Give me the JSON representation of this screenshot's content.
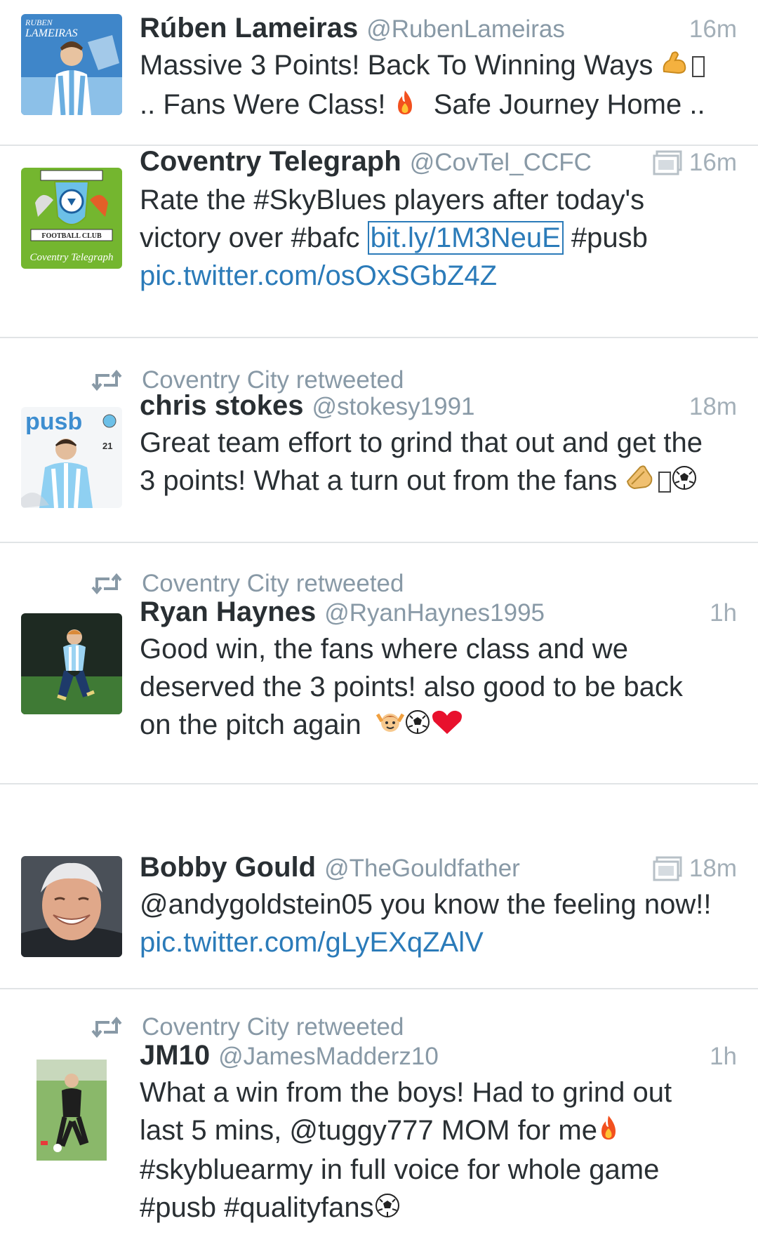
{
  "retweet_label": "Coventry City retweeted",
  "tweets": [
    {
      "name": "Rúben Lameiras",
      "handle": "@RubenLameiras",
      "time": "16m",
      "avatar_text": [
        "RUBEN",
        "LAMEIRAS"
      ],
      "lines": [
        "Massive 3 Points! Back To Winning Ways",
        ".. Fans Were Class!",
        "Safe Journey Home .."
      ]
    },
    {
      "name": "Coventry Telegraph",
      "handle": "@CovTel_CCFC",
      "time": "16m",
      "avatar_text": [
        "FOOTBALL CLUB",
        "Coventry Telegraph"
      ],
      "line1": "Rate the #SkyBlues players after today's",
      "line2_pre": "victory over #bafc ",
      "line2_link": "bit.ly/1M3NeuE",
      "line2_post": " #pusb",
      "line3_link": "pic.twitter.com/osOxSGbZ4Z"
    },
    {
      "name": "chris stokes",
      "handle": "@stokesy1991",
      "time": "18m",
      "avatar_text": [
        "pusb",
        "21"
      ],
      "lines": [
        "Great team effort to grind that out and get the",
        "3 points! What a turn out from the fans"
      ]
    },
    {
      "name": "Ryan Haynes",
      "handle": "@RyanHaynes1995",
      "time": "1h",
      "lines": [
        "Good win, the fans where class and we",
        "deserved the 3 points! also good to be back",
        "on the pitch again"
      ]
    },
    {
      "name": "Bobby Gould",
      "handle": "@TheGouldfather",
      "time": "18m",
      "line1": "@andygoldstein05 you know the feeling now!!",
      "line2_link": "pic.twitter.com/gLyEXqZAlV"
    },
    {
      "name": "JM10",
      "handle": "@JamesMadderz10",
      "time": "1h",
      "lines": [
        "What a win from the boys! Had to grind out",
        "last 5 mins, @tuggy777 MOM for me",
        "#skybluearmy in full voice for whole game",
        "#pusb #qualityfans"
      ]
    }
  ],
  "colors": {
    "link": "#2b7bb9",
    "meta": "#8899a6",
    "text": "#292f33",
    "divider": "#e1e4e6"
  },
  "icons": [
    "retweet-icon",
    "media-icon",
    "flexed-biceps-emoji",
    "fire-emoji",
    "clapping-hands-emoji",
    "soccer-ball-emoji",
    "raising-hands-person-emoji",
    "red-heart-emoji"
  ]
}
